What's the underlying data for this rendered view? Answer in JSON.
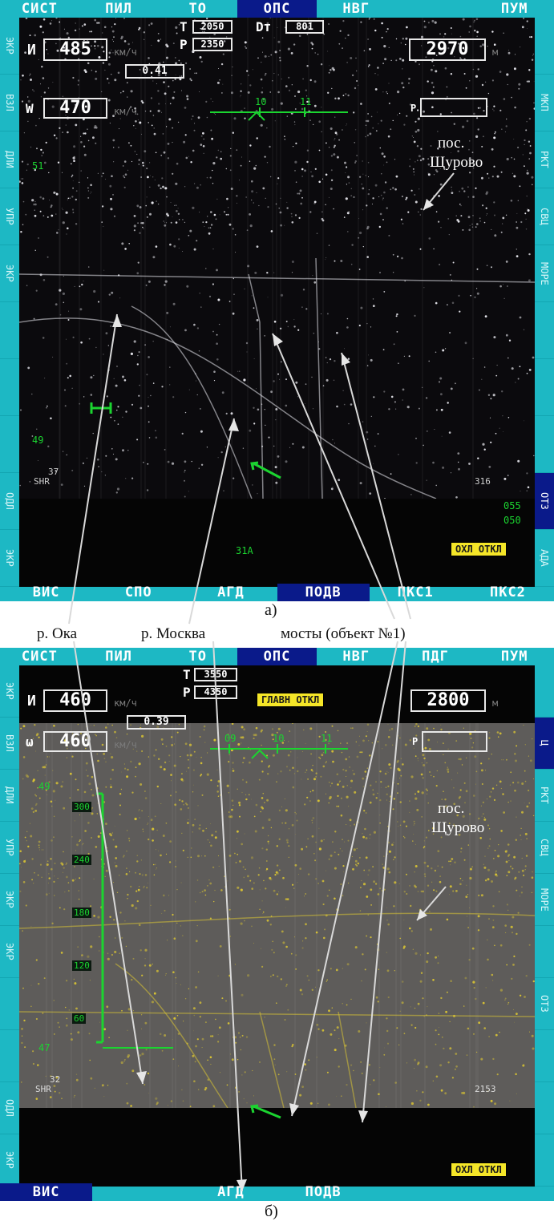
{
  "panel_a": {
    "top_tabs": [
      "СИСТ",
      "ПИЛ",
      "ТО",
      "ОПС",
      "НВГ",
      "",
      "ПУМ"
    ],
    "active_top_tab": 3,
    "bottom_tabs": [
      "ВИС",
      "СПО",
      "АГД",
      "ПОДВ",
      "ПКС1",
      "ПКС2"
    ],
    "active_bottom_tab": 3,
    "left_side_labels": [
      "ЭКР",
      "ВЗЛ",
      "ДЛИ",
      "УПР",
      "ЭКР",
      "",
      "",
      "",
      "ОДЛ",
      "ЭКР"
    ],
    "right_side_labels": [
      "",
      "МКП",
      "РКТ",
      "СВЦ",
      "МОРЕ",
      "",
      "",
      "",
      "ОТЗ",
      "АДА"
    ],
    "right_active_index": 8,
    "speed_label": "И",
    "speed_value": "485",
    "speed_unit": "км/ч",
    "ground_speed_label": "W",
    "ground_speed_value": "470",
    "ground_speed_unit": "км/ч",
    "ratio_value": "0.41",
    "t_label": "Т",
    "t_value": "2050",
    "dt_label": "Dт",
    "dt_value": "801",
    "p_label": "Р",
    "p_value": "2350",
    "range_value": "2970",
    "range_unit": "м",
    "p_box_label": "Р",
    "heading_ticks": [
      "10",
      "11"
    ],
    "scale_top": "51",
    "scale_bottom": "49",
    "lower_left_num": "37",
    "lower_left_label": "SHR",
    "lower_right_num": "316",
    "right_readout_1": "055",
    "right_readout_2": "050",
    "bottom_center_label": "31А",
    "status_badge": "ОХЛ ОТКЛ",
    "annotation_settlement_line1": "пос.",
    "annotation_settlement_line2": "Щурово",
    "caption": "а)"
  },
  "legend": {
    "oka": "р. Ока",
    "moskva": "р. Москва",
    "bridges": "мосты (объект №1)"
  },
  "panel_b": {
    "top_tabs": [
      "СИСТ",
      "ПИЛ",
      "ТО",
      "ОПС",
      "НВГ",
      "ПДГ",
      "ПУМ"
    ],
    "active_top_tab": 3,
    "bottom_tabs": [
      "ВИС",
      "",
      "АГД",
      "ПОДВ",
      "",
      ""
    ],
    "active_bottom_tab": 0,
    "left_side_labels": [
      "ЭКР",
      "ВЗЛ",
      "ДЛИ",
      "УПР",
      "ЭКР",
      "ЭКР",
      "",
      "",
      "ОДЛ",
      "ЭКР"
    ],
    "right_side_labels": [
      "",
      "Ц",
      "РКТ",
      "СВЦ",
      "МОРЕ",
      "",
      "ОТЗ",
      "",
      "",
      ""
    ],
    "right_active_index": 1,
    "speed_label": "И",
    "speed_value": "460",
    "speed_unit": "км/ч",
    "ground_speed_label": "ω",
    "ground_speed_value": "460",
    "ground_speed_unit": "км/ч",
    "ratio_value": "0.39",
    "t_label": "Т",
    "t_value": "3550",
    "p_label": "Р",
    "p_value": "4350",
    "warning_badge": "ГЛАВН ОТКЛ",
    "range_value": "2800",
    "range_unit": "м",
    "p_box_label": "Р",
    "heading_ticks": [
      "09",
      "10",
      "11"
    ],
    "scale_top": "49",
    "scale_bottom": "47",
    "scale_marks": [
      "300",
      "240",
      "180",
      "120",
      "60"
    ],
    "lower_left_num": "32",
    "lower_left_label": "SHR",
    "lower_right_num": "2153",
    "status_badge": "ОХЛ ОТКЛ",
    "annotation_settlement_line1": "пос.",
    "annotation_settlement_line2": "Щурово",
    "caption": "б)"
  },
  "colors": {
    "frame": "#1db8c4",
    "active_tab": "#0a1a8a",
    "symbology": "#1bd430",
    "badge": "#f5e628"
  }
}
